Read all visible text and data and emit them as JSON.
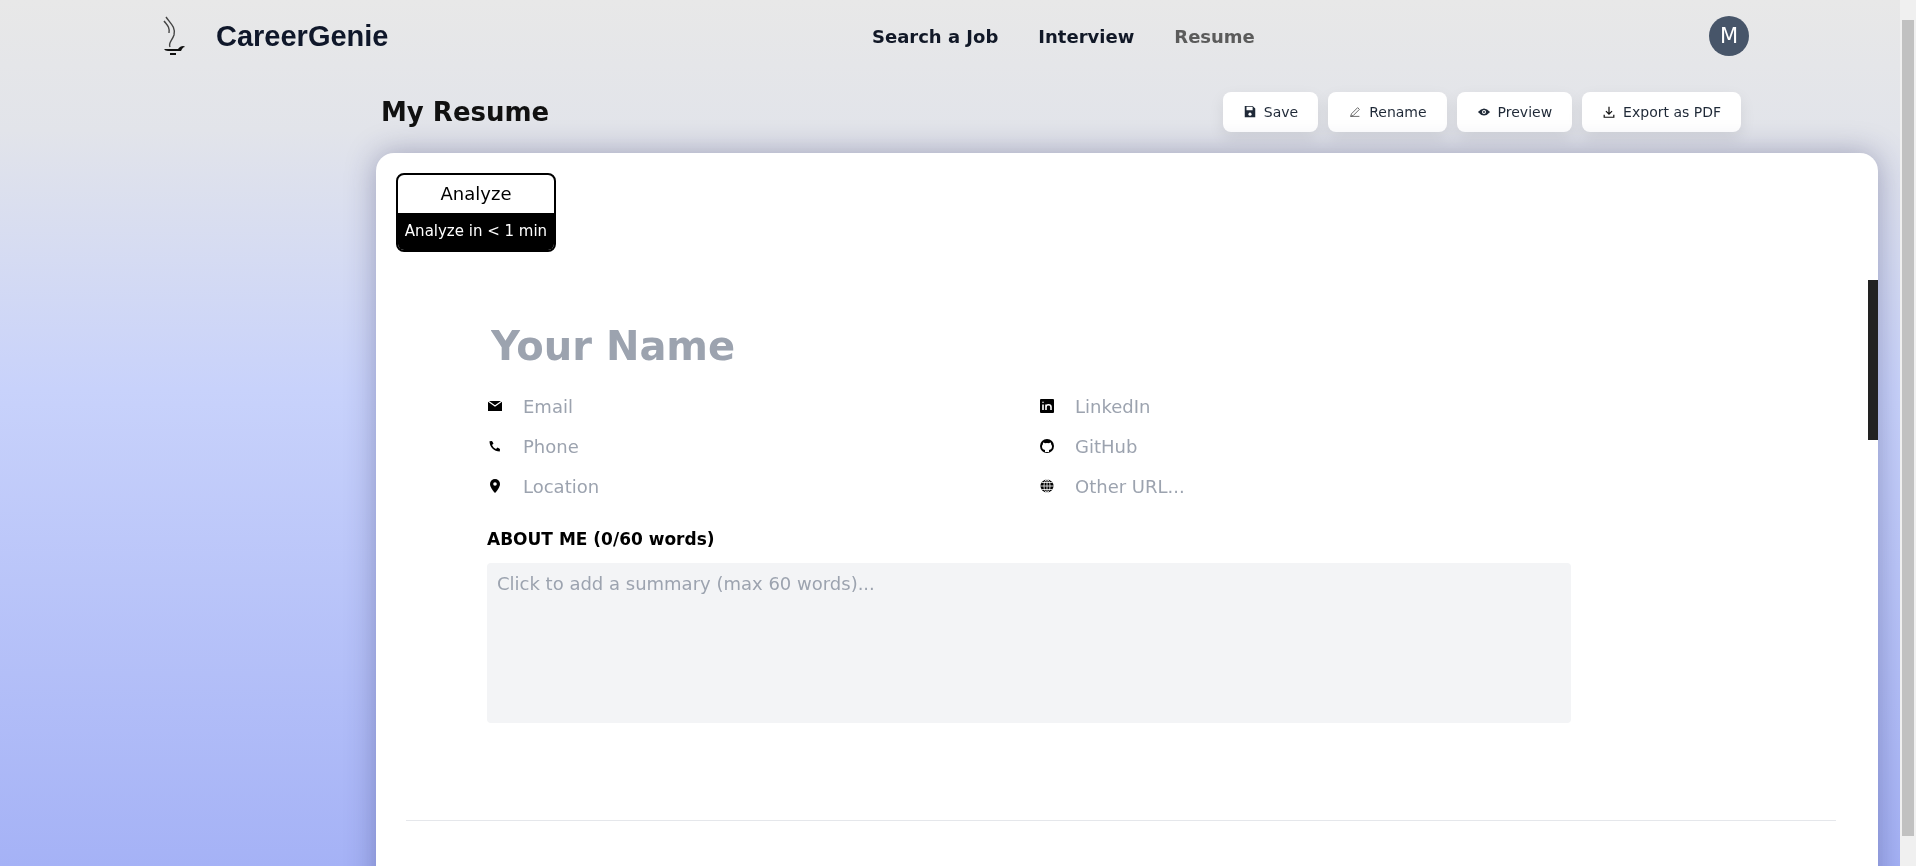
{
  "header": {
    "brand": "CareerGenie",
    "nav": [
      {
        "label": "Search a Job",
        "selected": false
      },
      {
        "label": "Interview",
        "selected": false
      },
      {
        "label": "Resume",
        "selected": true
      }
    ],
    "avatar": "M"
  },
  "page": {
    "title": "My Resume",
    "actions": [
      {
        "kind": "save",
        "label": "Save"
      },
      {
        "kind": "rename",
        "label": "Rename"
      },
      {
        "kind": "preview",
        "label": "Preview"
      },
      {
        "kind": "export",
        "label": "Export as PDF"
      }
    ]
  },
  "analyze": {
    "label": "Analyze",
    "caption": "Analyze in < 1 min"
  },
  "resume": {
    "name_placeholder": "Your Name",
    "contacts": [
      {
        "kind": "email",
        "placeholder": "Email"
      },
      {
        "kind": "linkedin",
        "placeholder": "LinkedIn"
      },
      {
        "kind": "phone",
        "placeholder": "Phone"
      },
      {
        "kind": "github",
        "placeholder": "GitHub"
      },
      {
        "kind": "location",
        "placeholder": "Location"
      },
      {
        "kind": "web",
        "placeholder": "Other URL..."
      }
    ],
    "about_label": "ABOUT ME (0/60 words)",
    "about_placeholder": "Click to add a summary (max 60 words)..."
  }
}
